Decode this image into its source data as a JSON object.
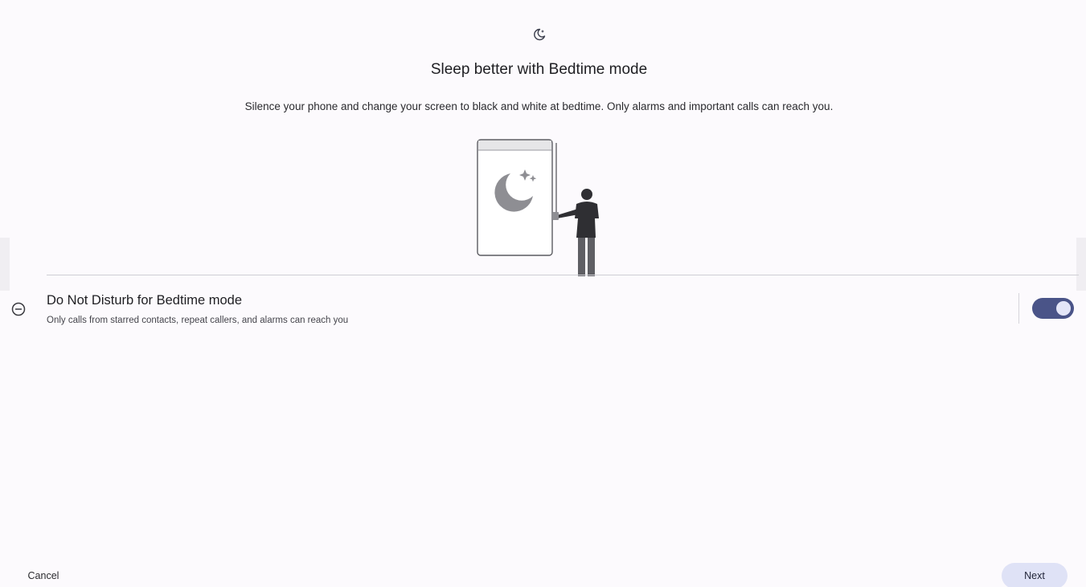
{
  "header": {
    "icon": "bedtime-moon-icon",
    "title": "Sleep better with Bedtime mode",
    "subtitle": "Silence your phone and change your screen to black and white at bedtime. Only alarms and important calls can reach you."
  },
  "illustration": {
    "icon": "phone-moon-person-illustration"
  },
  "setting": {
    "icon": "do-not-disturb-icon",
    "title": "Do Not Disturb for Bedtime mode",
    "description": "Only calls from starred contacts, repeat callers, and alarms can reach you",
    "enabled": true
  },
  "footer": {
    "cancel_label": "Cancel",
    "next_label": "Next"
  },
  "colors": {
    "background": "#fcfafd",
    "toggle_track": "#4a5488",
    "toggle_knob": "#e4e6f8",
    "next_button_bg": "#dfe2f6"
  }
}
